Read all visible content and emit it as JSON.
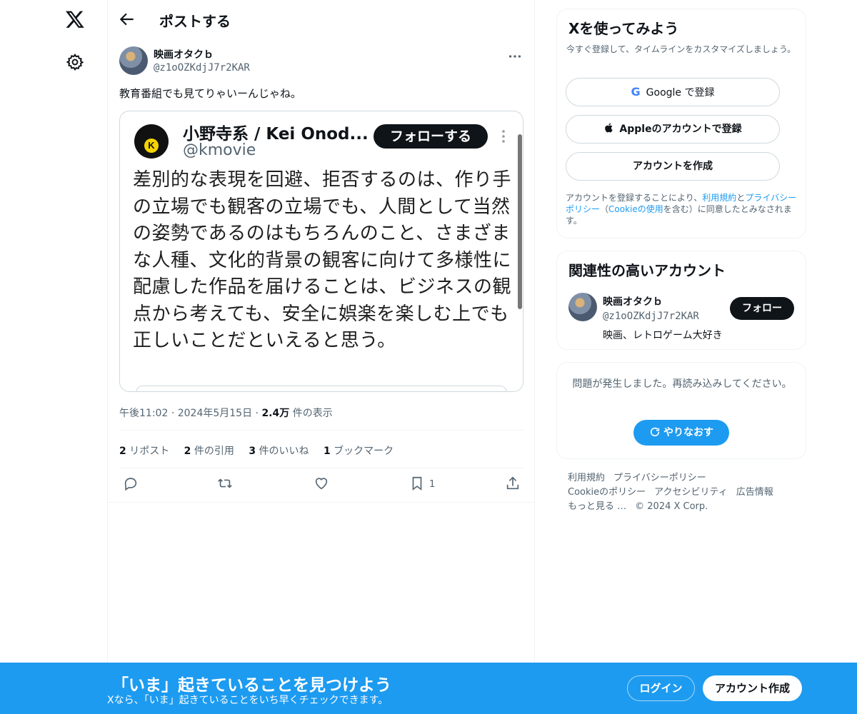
{
  "header": {
    "title": "ポストする"
  },
  "post": {
    "author_name": "映画オタクｂ",
    "author_handle": "@z1oOZKdjJ7r2KAR",
    "text": "教育番組でも見てりゃいーんじゃね。",
    "media": {
      "name": "小野寺系 / Kei Onod...",
      "handle": "@kmovie",
      "follow_label": "フォローする",
      "avatar_letter": "K",
      "body": "差別的な表現を回避、拒否するのは、作り手の立場でも観客の立場でも、人間として当然の姿勢であるのはもちろんのこと、さまざまな人種、文化的背景の観客に向けて多様性に配慮した作品を届けることは、ビジネスの観点から考えても、安全に娯楽を楽しむ上でも正しいことだといえると思う。"
    },
    "time": "午後11:02",
    "date": "2024年5月15日",
    "views_count": "2.4万",
    "views_label": " 件の表示",
    "sep": "·",
    "stats": [
      {
        "count": "2",
        "label": " リポスト"
      },
      {
        "count": "2",
        "label": " 件の引用"
      },
      {
        "count": "3",
        "label": " 件のいいね"
      },
      {
        "count": "1",
        "label": " ブックマーク"
      }
    ],
    "bookmark_count": "1"
  },
  "signup": {
    "title": "Xを使ってみよう",
    "desc": "今すぐ登録して、タイムラインをカスタマイズしましょう。",
    "google_label": "Google で登録",
    "google_letter": "G",
    "apple_label": "Appleのアカウントで登録",
    "create_label": "アカウントを作成",
    "terms_prefix": "アカウントを登録することにより、",
    "terms_link": "利用規約",
    "terms_mid": "と",
    "privacy_link": "プライバシーポリシー",
    "terms_mid2": "（",
    "cookie_link": "Cookieの使用",
    "terms_suffix": "を含む）に同意したとみなされます。"
  },
  "related": {
    "title": "関連性の高いアカウント",
    "name": "映画オタクｂ",
    "handle": "@z1oOZKdjJ7r2KAR",
    "bio": "映画、レトロゲーム大好き",
    "follow_label": "フォロー"
  },
  "error": {
    "text": "問題が発生しました。再読み込みしてください。",
    "retry_label": "やりなおす"
  },
  "footer": {
    "links": [
      "利用規約",
      "プライバシーポリシー",
      "Cookieのポリシー",
      "アクセシビリティ",
      "広告情報",
      "もっと見る …"
    ],
    "copyright": "© 2024 X Corp."
  },
  "banner": {
    "title": "「いま」起きていることを見つけよう",
    "subtitle": "Xなら、「いま」起きていることをいち早くチェックできます。",
    "login_label": "ログイン",
    "signup_label": "アカウント作成"
  },
  "colors": {
    "accent": "#1d9bf0",
    "text": "#0f1419",
    "muted": "#536471"
  }
}
